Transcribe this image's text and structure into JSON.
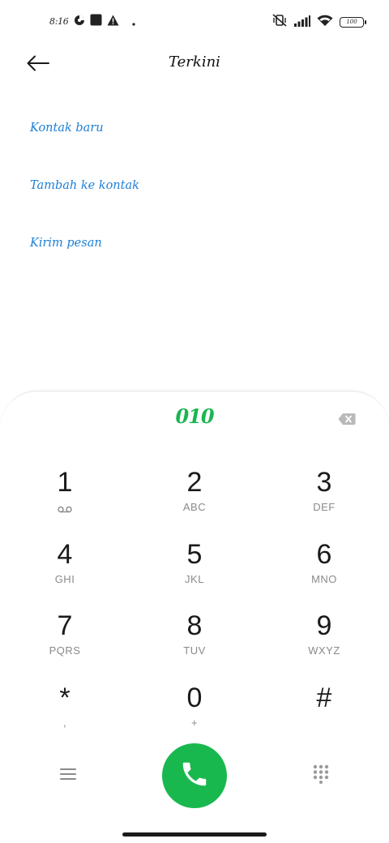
{
  "status_bar": {
    "time": "8:16",
    "battery": "100",
    "icons": [
      "data-saver-icon",
      "square-notification-icon",
      "warning-icon",
      "dot-icon",
      "muted-vibrate-icon",
      "signal-icon",
      "wifi-icon",
      "battery-icon"
    ]
  },
  "header": {
    "title": "Terkini",
    "back_icon": "arrow-left-icon"
  },
  "options": [
    {
      "label": "Kontak baru"
    },
    {
      "label": "Tambah ke kontak"
    },
    {
      "label": "Kirim pesan"
    }
  ],
  "dialer": {
    "number": "010",
    "backspace_icon": "backspace-icon",
    "keys": [
      {
        "digit": "1",
        "letters": ""
      },
      {
        "digit": "2",
        "letters": "ABC"
      },
      {
        "digit": "3",
        "letters": "DEF"
      },
      {
        "digit": "4",
        "letters": "GHI"
      },
      {
        "digit": "5",
        "letters": "JKL"
      },
      {
        "digit": "6",
        "letters": "MNO"
      },
      {
        "digit": "7",
        "letters": "PQRS"
      },
      {
        "digit": "8",
        "letters": "TUV"
      },
      {
        "digit": "9",
        "letters": "WXYZ"
      },
      {
        "digit": "*",
        "letters": ","
      },
      {
        "digit": "0",
        "letters": "+"
      },
      {
        "digit": "#",
        "letters": ""
      }
    ]
  },
  "bottom_bar": {
    "menu_icon": "menu-icon",
    "call_icon": "phone-icon",
    "keypad_icon": "dialpad-icon"
  },
  "colors": {
    "accent_blue": "#1c7fd6",
    "call_green": "#19b84f",
    "number_green": "#1ab551"
  }
}
